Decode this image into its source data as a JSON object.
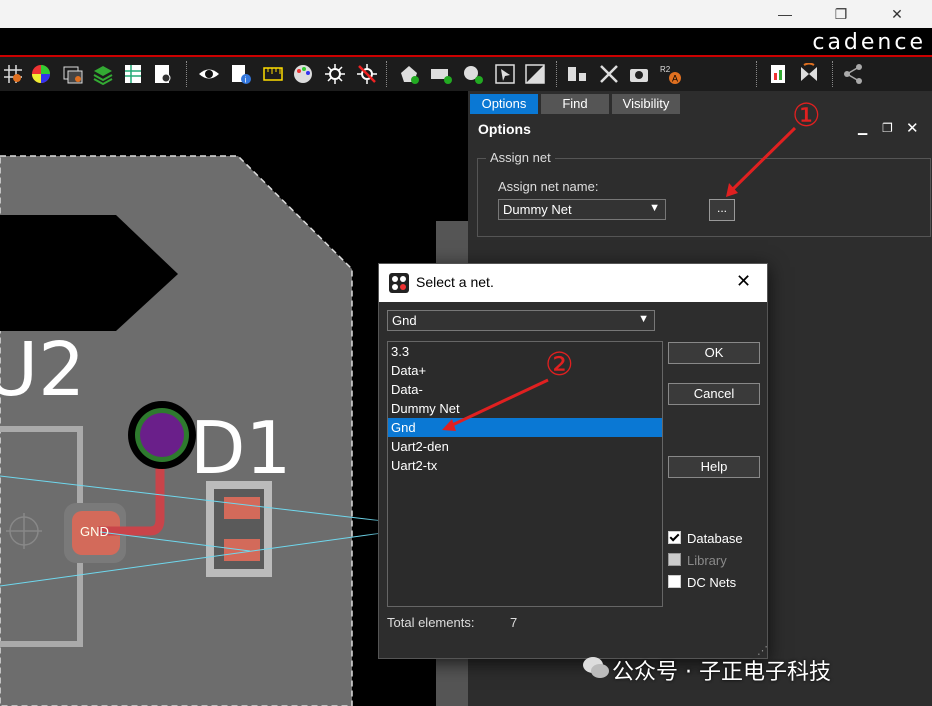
{
  "brand": "cadence",
  "window_controls": {
    "minimize": "—",
    "restore": "❐",
    "close": "✕"
  },
  "panel": {
    "tabs": [
      {
        "label": "Options"
      },
      {
        "label": "Find"
      },
      {
        "label": "Visibility"
      }
    ],
    "title": "Options",
    "group_label": "Assign net",
    "net_name_label": "Assign net name:",
    "net_name_value": "Dummy Net",
    "browse_label": "..."
  },
  "dialog": {
    "title": "Select a net.",
    "filter_value": "Gnd",
    "nets": [
      "3.3",
      "Data+",
      "Data-",
      "Dummy Net",
      "Gnd",
      "Uart2-den",
      "Uart2-tx"
    ],
    "selected": "Gnd",
    "ok_label": "OK",
    "cancel_label": "Cancel",
    "help_label": "Help",
    "checkboxes": [
      {
        "label": "Database",
        "checked": true,
        "enabled": true
      },
      {
        "label": "Library",
        "checked": false,
        "enabled": false
      },
      {
        "label": "DC Nets",
        "checked": false,
        "enabled": true
      }
    ],
    "total_label": "Total elements:",
    "total_value": "7"
  },
  "pcb": {
    "refdes_u2": "U2",
    "refdes_d1": "D1",
    "pad_label": "GND"
  },
  "annotations": {
    "step1": "①",
    "step2": "②"
  },
  "watermark": "公众号 · 子正电子科技",
  "colors": {
    "selection": "#0a78d4",
    "accent_red": "#e02020",
    "board": "#6d6d6d",
    "via": "#6a1f8a"
  }
}
